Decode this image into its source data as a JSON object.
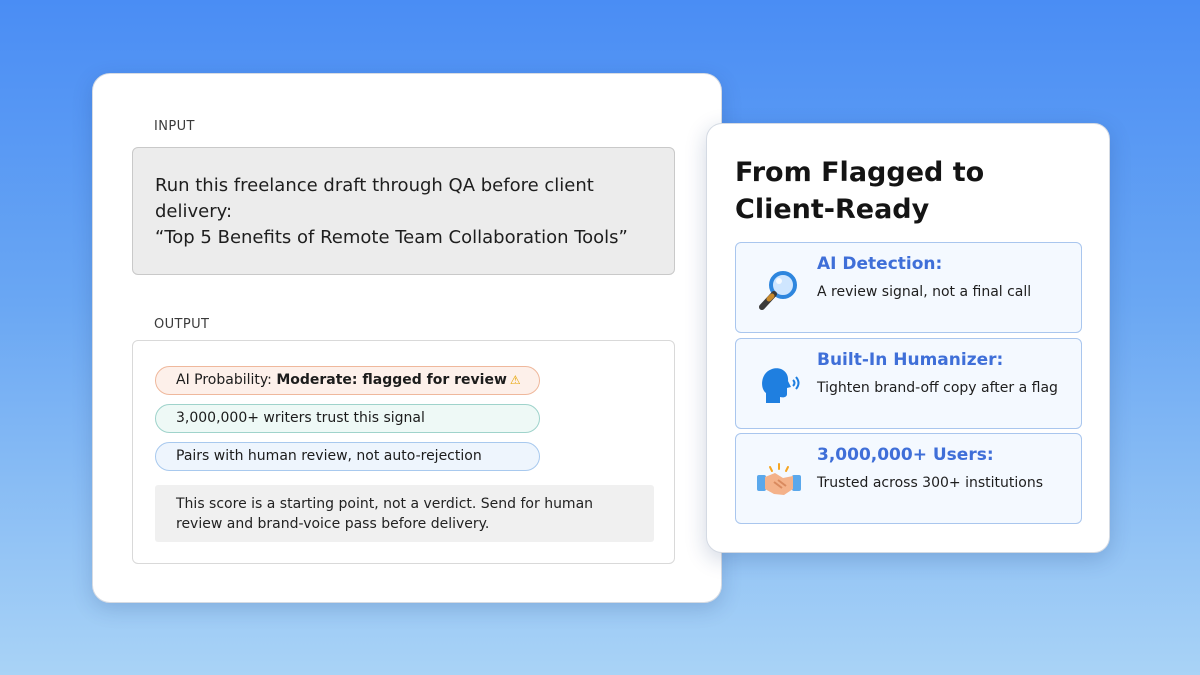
{
  "input": {
    "label": "INPUT",
    "line1": "Run this freelance draft through QA before client",
    "line2": "delivery:",
    "line3": "“Top 5 Benefits of Remote Team Collaboration Tools”"
  },
  "output": {
    "label": "OUTPUT",
    "pills": [
      {
        "prefix": "AI Probability: ",
        "bold": "Moderate: flagged for review",
        "icon": "warning-icon"
      },
      {
        "text": "3,000,000+ writers trust this signal"
      },
      {
        "text": "Pairs with human review, not auto-rejection"
      }
    ],
    "note": "This score is a starting point, not a verdict. Send for human review and brand-voice pass before delivery."
  },
  "panel": {
    "title_line1": "From Flagged to",
    "title_line2": "Client-Ready",
    "features": [
      {
        "icon": "magnifying-glass-icon",
        "heading": "AI Detection:",
        "desc": "A review signal, not a final call"
      },
      {
        "icon": "speaking-head-icon",
        "heading": "Built-In Humanizer:",
        "desc": "Tighten brand-off copy after a flag"
      },
      {
        "icon": "handshake-icon",
        "heading": "3,000,000+ Users:",
        "desc": "Trusted across 300+ institutions"
      }
    ]
  },
  "colors": {
    "accent": "#3f6fd8",
    "background_top": "#4a8df4",
    "background_bottom": "#a9d3f6"
  }
}
